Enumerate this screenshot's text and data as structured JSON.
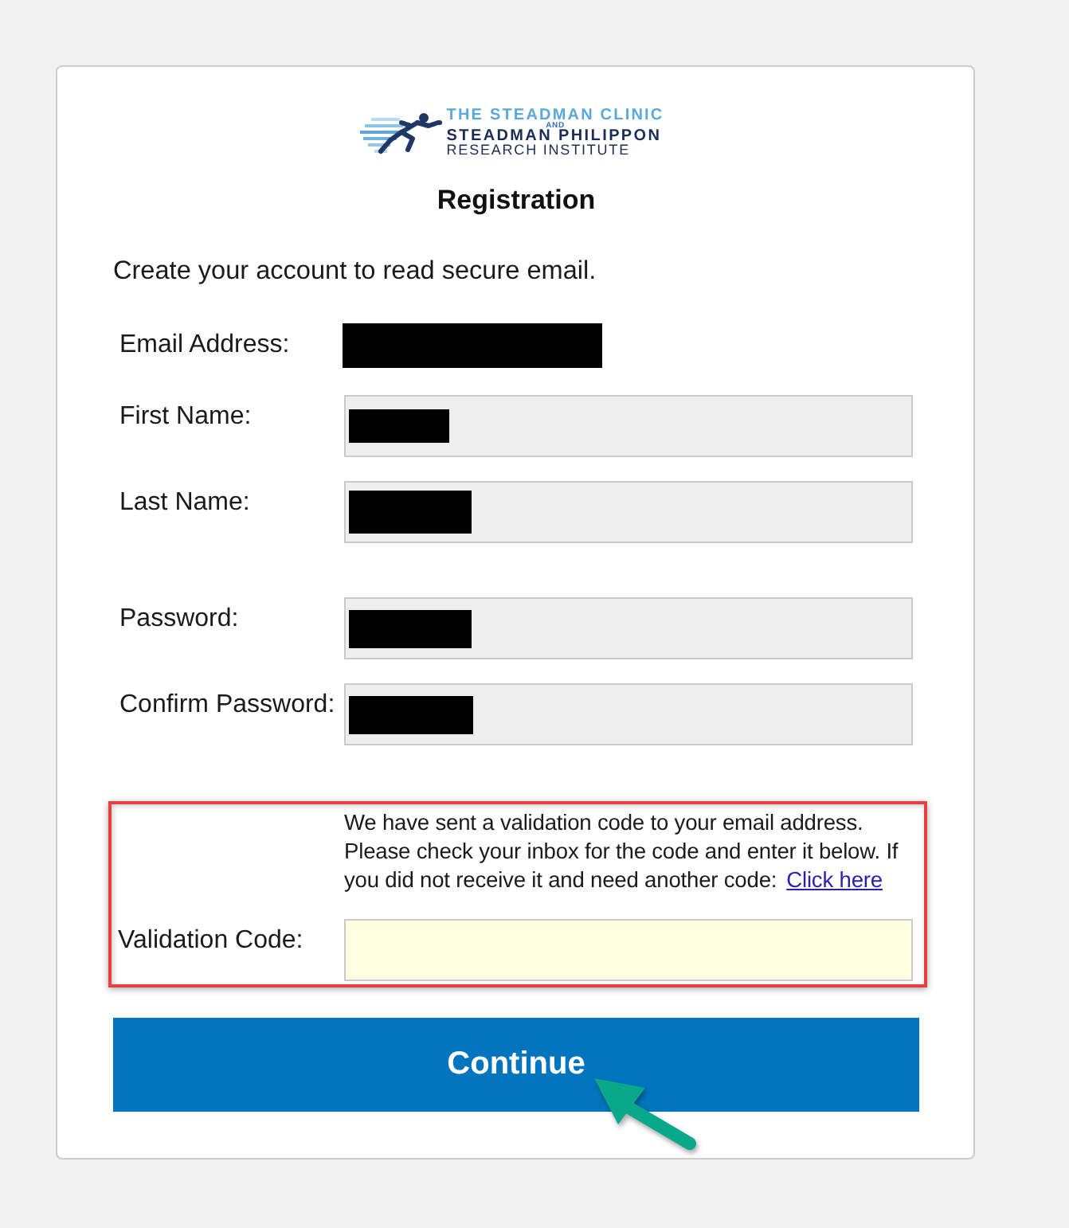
{
  "logo": {
    "name_line_1": "THE STEADMAN CLINIC",
    "conjunction": "AND",
    "name_line_2": "STEADMAN PHILIPPON",
    "name_line_3": "RESEARCH INSTITUTE"
  },
  "title": "Registration",
  "intro": "Create your account to read secure email.",
  "profile_fields": [
    {
      "kind": "static",
      "label": "Email Address:",
      "redacted": true
    },
    {
      "kind": "input",
      "label": "First Name:",
      "disabled": true,
      "redacted": true
    },
    {
      "kind": "input",
      "label": "Last Name:",
      "disabled": true,
      "redacted": true
    }
  ],
  "password_fields": [
    {
      "kind": "input",
      "label": "Password:",
      "disabled": true,
      "redacted": true
    },
    {
      "kind": "input",
      "label": "Confirm Password:",
      "disabled": true,
      "redacted": true
    }
  ],
  "validation": {
    "highlighted": true,
    "message": "We have sent a validation code to your email address. Please check your inbox for the code and enter it below. If you did not receive it and need another code:",
    "link": "Click here",
    "label": "Validation Code:",
    "disabled": false
  },
  "continue_button": {
    "label": "Continue",
    "pointed_at": true
  }
}
